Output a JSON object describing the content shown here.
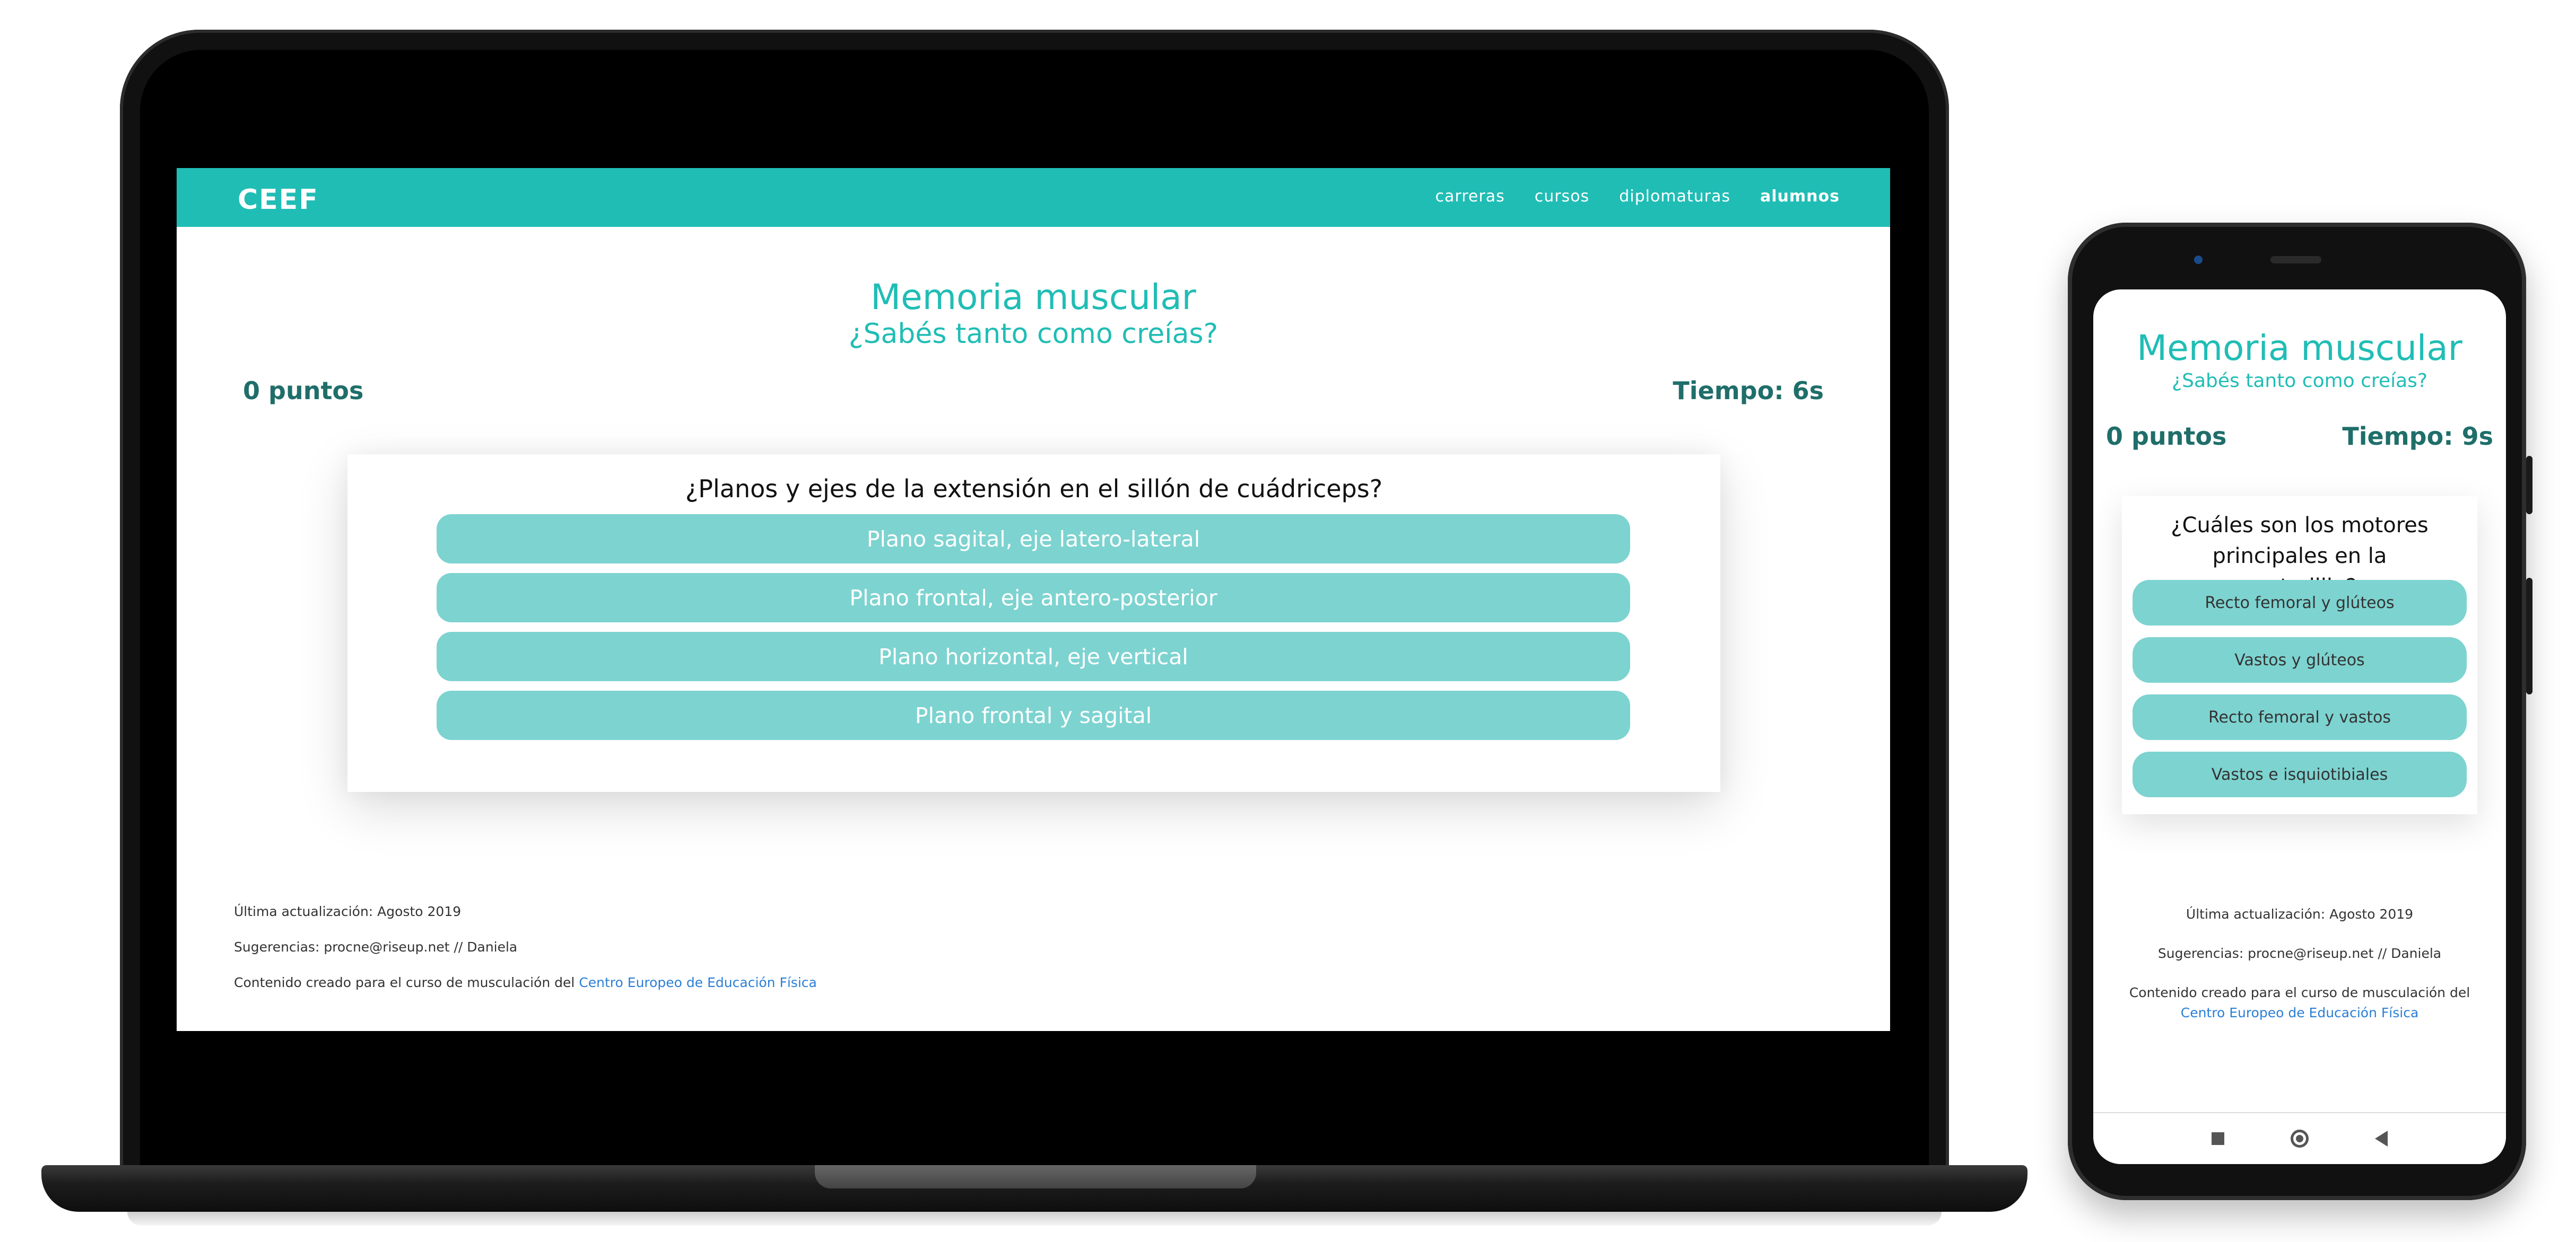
{
  "laptop": {
    "nav": {
      "logo": "CEEF",
      "links": [
        "carreras",
        "cursos",
        "diplomaturas",
        "alumnos"
      ]
    },
    "title": "Memoria muscular",
    "subtitle": "¿Sabés tanto como creías?",
    "score": "0 puntos",
    "timer": "Tiempo: 6s",
    "question": "¿Planos y ejes de la extensión en el sillón de cuádriceps?",
    "options": [
      "Plano sagital, eje latero-lateral",
      "Plano frontal, eje antero-posterior",
      "Plano horizontal, eje vertical",
      "Plano frontal y sagital"
    ],
    "footer": {
      "updated": "Última actualización: Agosto 2019",
      "suggestions": "Sugerencias: procne@riseup.net // Daniela",
      "credit_prefix": "Contenido creado para el curso de musculación del ",
      "credit_link": "Centro Europeo de Educación Física"
    }
  },
  "phone": {
    "title": "Memoria muscular",
    "subtitle": "¿Sabés tanto como creías?",
    "score": "0 puntos",
    "timer": "Tiempo: 9s",
    "question": "¿Cuáles son los motores principales en la sentadilla?",
    "options": [
      "Recto femoral y glúteos",
      "Vastos y glúteos",
      "Recto femoral y vastos",
      "Vastos e isquiotibiales"
    ],
    "footer": {
      "updated": "Última actualización: Agosto 2019",
      "suggestions": "Sugerencias: procne@riseup.net // Daniela",
      "credit_prefix": "Contenido creado para el curso de musculación del ",
      "credit_link": "Centro Europeo de Educación Física"
    }
  },
  "colors": {
    "accent": "#20bdb5",
    "option_bg": "#7dd3d0",
    "score_text": "#1f6e6a",
    "link": "#2b7fd6"
  }
}
